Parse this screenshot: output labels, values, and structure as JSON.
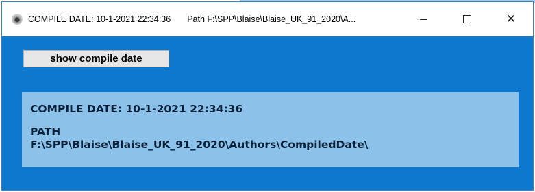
{
  "window": {
    "title_compile": "COMPILE DATE: 10-1-2021 22:34:36",
    "title_path": "Path F:\\SPP\\Blaise\\Blaise_UK_91_2020\\A...",
    "minimize_icon": "minimize-icon",
    "maximize_icon": "maximize-icon",
    "close_label": "✕"
  },
  "toolbar": {
    "show_button_label": "show compile date"
  },
  "info": {
    "compile_line": "COMPILE DATE: 10-1-2021 22:34:36",
    "path_label": "PATH",
    "path_value": "F:\\SPP\\Blaise\\Blaise_UK_91_2020\\Authors\\CompiledDate\\"
  },
  "colors": {
    "client_background": "#0c79cf",
    "info_panel_background": "#8cc2ea",
    "button_background": "#e6e6e6"
  }
}
